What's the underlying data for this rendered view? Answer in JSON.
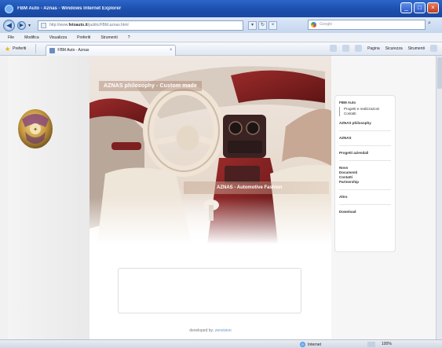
{
  "window": {
    "title": "FBM Auto - Aznas - Windows Internet Explorer",
    "minimize": "_",
    "maximize": "□",
    "close": "×"
  },
  "address_bar": {
    "url_prefix": "http://www.",
    "url_host": "fetoauto.it",
    "url_suffix": "/public/FBM.aznas.html",
    "search_placeholder": "Google",
    "back": "◀",
    "forward": "▶"
  },
  "menu": {
    "items": [
      "File",
      "Modifica",
      "Visualizza",
      "Preferiti",
      "Strumenti",
      "?"
    ]
  },
  "favorites": {
    "label": "Preferiti",
    "tab_title": "FBM Auto - Aznas",
    "commands": [
      "Pagina",
      "Sicurezza",
      "Strumenti"
    ]
  },
  "page": {
    "hero_title": "AZNAS philosophy - Custom made",
    "hero_subtitle": "AZNAS - Automotive Fashion",
    "credit_prefix": "developed by:",
    "credit_link": "zenvision"
  },
  "nav": {
    "section_title": "FBM Auto",
    "sub_items": [
      "Progetti e realizzazioni",
      "Contatti"
    ],
    "items": [
      "AZNAS philosophy",
      "AZNAS",
      "Progetti aziendali",
      "Novo",
      "Documenti",
      "Contatti",
      "Partnership",
      "Altro",
      "Download"
    ]
  },
  "status": {
    "zone": "Internet",
    "zoom": "100%"
  }
}
